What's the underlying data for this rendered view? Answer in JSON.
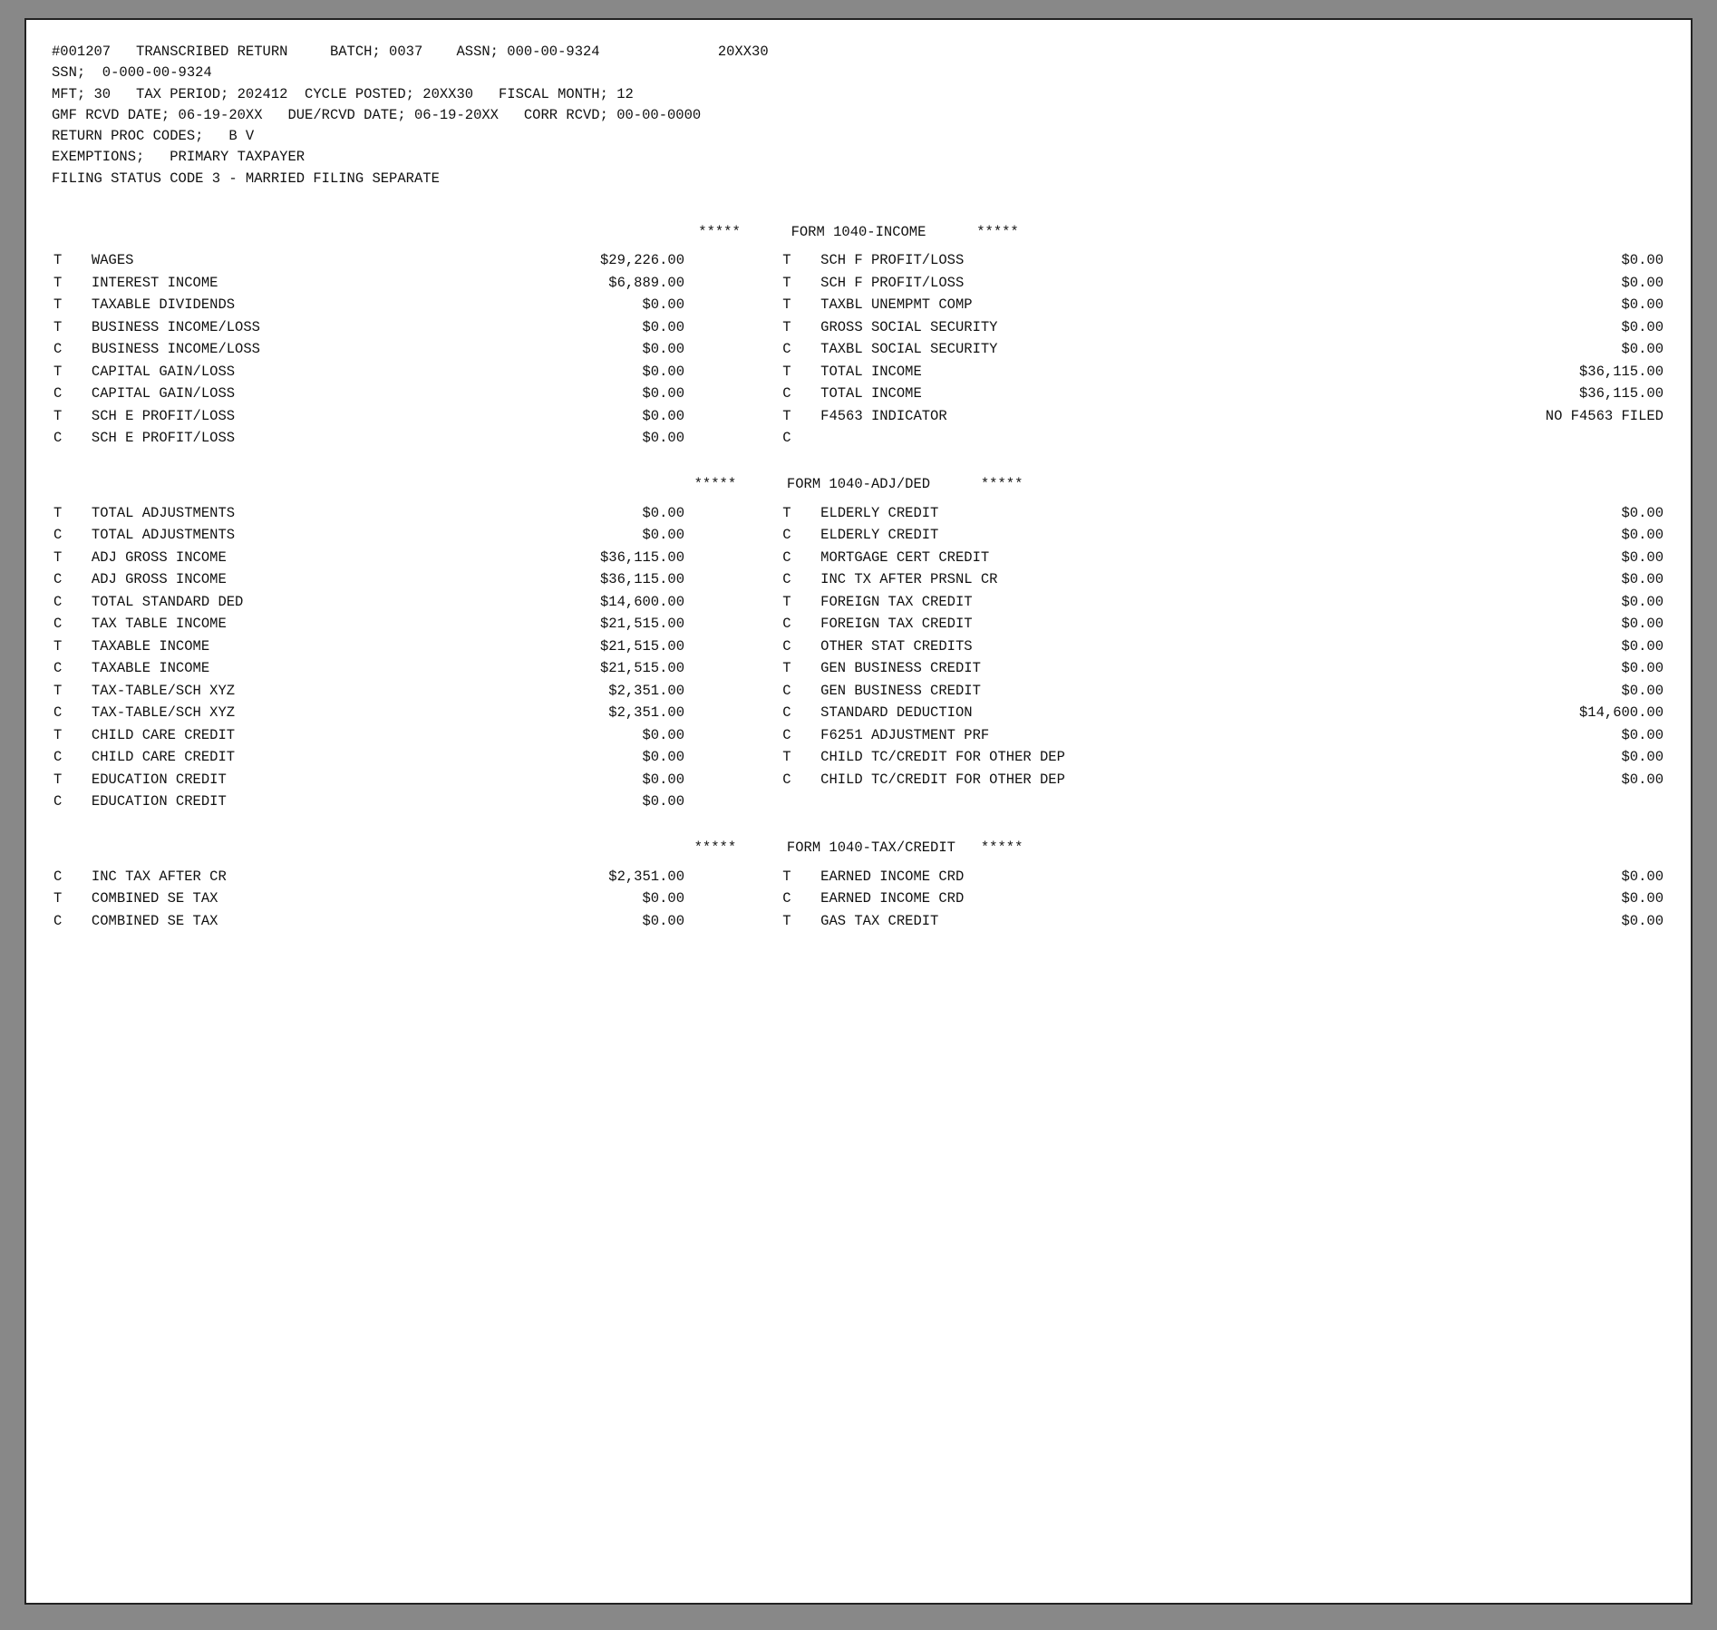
{
  "document": {
    "header": {
      "line1": "#001207   TRANSCRIBED RETURN     BATCH; 0037    ASSN; 000-00-9324              20XX30",
      "line2": "SSN;  0-000-00-9324",
      "line3": "MFT; 30   TAX PERIOD; 202412  CYCLE POSTED; 20XX30   FISCAL MONTH; 12",
      "line4": "GMF RCVD DATE; 06-19-20XX   DUE/RCVD DATE; 06-19-20XX   CORR RCVD; 00-00-0000",
      "line5": "RETURN PROC CODES;   B V",
      "line6": "EXEMPTIONS;   PRIMARY TAXPAYER",
      "line7": "FILING STATUS CODE 3 - MARRIED FILING SEPARATE"
    },
    "income_section": {
      "header": "*****      FORM 1040-INCOME      *****",
      "left_rows": [
        {
          "indicator": "T",
          "label": "WAGES",
          "value": "$29,226.00"
        },
        {
          "indicator": "T",
          "label": "INTEREST INCOME",
          "value": "$6,889.00"
        },
        {
          "indicator": "T",
          "label": "TAXABLE DIVIDENDS",
          "value": "$0.00"
        },
        {
          "indicator": "T",
          "label": "BUSINESS INCOME/LOSS",
          "value": "$0.00"
        },
        {
          "indicator": "C",
          "label": "BUSINESS INCOME/LOSS",
          "value": "$0.00"
        },
        {
          "indicator": "T",
          "label": "CAPITAL GAIN/LOSS",
          "value": "$0.00"
        },
        {
          "indicator": "C",
          "label": "CAPITAL GAIN/LOSS",
          "value": "$0.00"
        },
        {
          "indicator": "T",
          "label": "SCH E PROFIT/LOSS",
          "value": "$0.00"
        },
        {
          "indicator": "C",
          "label": "SCH E PROFIT/LOSS",
          "value": "$0.00"
        }
      ],
      "right_rows": [
        {
          "indicator": "T",
          "label": "SCH F PROFIT/LOSS",
          "value": "$0.00"
        },
        {
          "indicator": "T",
          "label": "SCH F PROFIT/LOSS",
          "value": "$0.00"
        },
        {
          "indicator": "T",
          "label": "TAXBL UNEMPMT COMP",
          "value": "$0.00"
        },
        {
          "indicator": "T",
          "label": "GROSS SOCIAL SECURITY",
          "value": "$0.00"
        },
        {
          "indicator": "C",
          "label": "TAXBL SOCIAL SECURITY",
          "value": "$0.00"
        },
        {
          "indicator": "T",
          "label": "TOTAL INCOME",
          "value": "$36,115.00"
        },
        {
          "indicator": "C",
          "label": "TOTAL INCOME",
          "value": "$36,115.00"
        },
        {
          "indicator": "T",
          "label": "F4563 INDICATOR",
          "value": "NO F4563 FILED"
        },
        {
          "indicator": "C",
          "label": "",
          "value": ""
        }
      ]
    },
    "adjded_section": {
      "header": "*****      FORM 1040-ADJ/DED      *****",
      "left_rows": [
        {
          "indicator": "T",
          "label": "TOTAL ADJUSTMENTS",
          "value": "$0.00"
        },
        {
          "indicator": "C",
          "label": "TOTAL ADJUSTMENTS",
          "value": "$0.00"
        },
        {
          "indicator": "T",
          "label": "ADJ GROSS INCOME",
          "value": "$36,115.00"
        },
        {
          "indicator": "C",
          "label": "ADJ GROSS INCOME",
          "value": "$36,115.00"
        },
        {
          "indicator": "C",
          "label": "TOTAL STANDARD DED",
          "value": "$14,600.00"
        },
        {
          "indicator": "C",
          "label": "TAX TABLE INCOME",
          "value": "$21,515.00"
        },
        {
          "indicator": "T",
          "label": "TAXABLE INCOME",
          "value": "$21,515.00"
        },
        {
          "indicator": "C",
          "label": "TAXABLE INCOME",
          "value": "$21,515.00"
        },
        {
          "indicator": "T",
          "label": "TAX-TABLE/SCH XYZ",
          "value": "$2,351.00"
        },
        {
          "indicator": "C",
          "label": "TAX-TABLE/SCH XYZ",
          "value": "$2,351.00"
        },
        {
          "indicator": "T",
          "label": "CHILD CARE CREDIT",
          "value": "$0.00"
        },
        {
          "indicator": "C",
          "label": "CHILD CARE CREDIT",
          "value": "$0.00"
        },
        {
          "indicator": "T",
          "label": "EDUCATION CREDIT",
          "value": "$0.00"
        },
        {
          "indicator": "C",
          "label": "EDUCATION CREDIT",
          "value": "$0.00"
        }
      ],
      "right_rows": [
        {
          "indicator": "T",
          "label": "ELDERLY CREDIT",
          "value": "$0.00"
        },
        {
          "indicator": "C",
          "label": "ELDERLY CREDIT",
          "value": "$0.00"
        },
        {
          "indicator": "C",
          "label": "MORTGAGE CERT CREDIT",
          "value": "$0.00"
        },
        {
          "indicator": "C",
          "label": "INC TX AFTER PRSNL CR",
          "value": "$0.00"
        },
        {
          "indicator": "T",
          "label": "FOREIGN TAX CREDIT",
          "value": "$0.00"
        },
        {
          "indicator": "C",
          "label": "FOREIGN TAX CREDIT",
          "value": "$0.00"
        },
        {
          "indicator": "C",
          "label": "OTHER STAT CREDITS",
          "value": "$0.00"
        },
        {
          "indicator": "T",
          "label": "GEN BUSINESS CREDIT",
          "value": "$0.00"
        },
        {
          "indicator": "C",
          "label": "GEN BUSINESS CREDIT",
          "value": "$0.00"
        },
        {
          "indicator": "C",
          "label": "STANDARD DEDUCTION",
          "value": "$14,600.00"
        },
        {
          "indicator": "C",
          "label": "F6251 ADJUSTMENT PRF",
          "value": "$0.00"
        },
        {
          "indicator": "T",
          "label": "CHILD TC/CREDIT FOR OTHER DEP",
          "value": "$0.00"
        },
        {
          "indicator": "C",
          "label": "CHILD TC/CREDIT FOR OTHER DEP",
          "value": "$0.00"
        },
        {
          "indicator": "",
          "label": "",
          "value": ""
        }
      ]
    },
    "taxcredit_section": {
      "header": "*****      FORM 1040-TAX/CREDIT   *****",
      "left_rows": [
        {
          "indicator": "C",
          "label": "INC TAX AFTER CR",
          "value": "$2,351.00"
        },
        {
          "indicator": "T",
          "label": "COMBINED SE TAX",
          "value": "$0.00"
        },
        {
          "indicator": "C",
          "label": "COMBINED SE TAX",
          "value": "$0.00"
        }
      ],
      "right_rows": [
        {
          "indicator": "T",
          "label": "EARNED INCOME CRD",
          "value": "$0.00"
        },
        {
          "indicator": "C",
          "label": "EARNED INCOME CRD",
          "value": "$0.00"
        },
        {
          "indicator": "T",
          "label": "GAS TAX CREDIT",
          "value": "$0.00"
        }
      ]
    }
  }
}
